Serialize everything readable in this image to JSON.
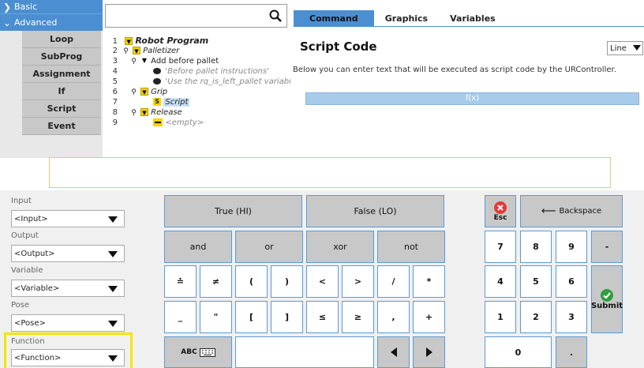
{
  "nav": {
    "basic_label": "Basic",
    "advanced_label": "Advanced",
    "items": [
      "Loop",
      "SubProg",
      "Assignment",
      "If",
      "Script",
      "Event"
    ]
  },
  "tree": {
    "lines": [
      {
        "num": "1",
        "text": "Robot Program"
      },
      {
        "num": "2",
        "text": "Palletizer"
      },
      {
        "num": "3",
        "text": "Add before pallet"
      },
      {
        "num": "4",
        "text": "'Before pallet instructions'"
      },
      {
        "num": "5",
        "text": "'Use the rq_is_left_pallet variabl"
      },
      {
        "num": "6",
        "text": "Grip"
      },
      {
        "num": "7",
        "text": "Script"
      },
      {
        "num": "8",
        "text": "Release"
      },
      {
        "num": "9",
        "text": "<empty>"
      }
    ]
  },
  "tabs": [
    "Command",
    "Graphics",
    "Variables"
  ],
  "script": {
    "title": "Script Code",
    "mode": "Line",
    "description": "Below you can enter text that will be executed as script code by the URController.",
    "fx_placeholder": "f(x)"
  },
  "dropdowns": [
    {
      "label": "Input",
      "value": "<Input>"
    },
    {
      "label": "Output",
      "value": "<Output>"
    },
    {
      "label": "Variable",
      "value": "<Variable>"
    },
    {
      "label": "Pose",
      "value": "<Pose>"
    },
    {
      "label": "Function",
      "value": "<Function>"
    }
  ],
  "keys": {
    "true_hi": "True (HI)",
    "false_lo": "False (LO)",
    "and": "and",
    "or": "or",
    "xor": "xor",
    "not": "not",
    "eq": "≐",
    "neq": "≠",
    "lparen": "(",
    "rparen": ")",
    "lt": "<",
    "gt": ">",
    "slash": "/",
    "star": "*",
    "underscore": "_",
    "quote": "\"",
    "lbracket": "[",
    "rbracket": "]",
    "le": "≤",
    "ge": "≥",
    "comma": ",",
    "plus": "+",
    "abc": "ABC",
    "esc": "Esc",
    "backspace": "Backspace",
    "submit": "Submit",
    "minus": "-",
    "dot": ".",
    "digits": [
      "7",
      "8",
      "9",
      "4",
      "5",
      "6",
      "1",
      "2",
      "3",
      "0"
    ]
  },
  "colors": {
    "accent": "#4b8fd2",
    "key_bg": "#c8c8c8",
    "highlight": "#f5e400",
    "esc_red": "#e53935",
    "submit_green": "#2e9e3e"
  }
}
